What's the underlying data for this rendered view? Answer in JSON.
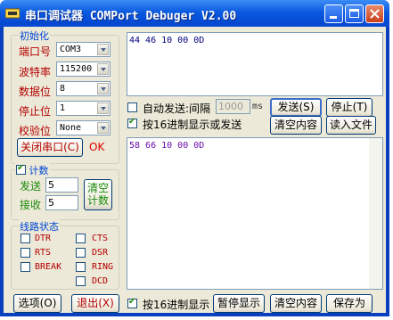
{
  "window": {
    "title": "串口调试器 COMPort Debuger V2.00"
  },
  "settings": {
    "group_label": "初始化",
    "port_label": "端口号",
    "port_value": "COM3",
    "baud_label": "波特率",
    "baud_value": "115200",
    "databits_label": "数据位",
    "databits_value": "8",
    "stopbits_label": "停止位",
    "stopbits_value": "1",
    "parity_label": "校验位",
    "parity_value": "None",
    "close_port_label": "关闭串口(C)",
    "status_text": "OK"
  },
  "count": {
    "label": "计数",
    "checked": true,
    "send_label": "发送",
    "send_value": "5",
    "recv_label": "接收",
    "recv_value": "5",
    "clear_label": "清空\n计数"
  },
  "line_status": {
    "label": "线路状态",
    "items": [
      "DTR",
      "CTS",
      "RTS",
      "DSR",
      "BREAK",
      "RING",
      "DCD"
    ]
  },
  "send_panel": {
    "text": "44 46 10 00 0D",
    "auto_send_label": "自动发送:间隔",
    "interval_value": "1000",
    "interval_unit": "ms",
    "send_button": "发送(S)",
    "stop_button": "停止(T)",
    "hex_send_label": "按16进制显示或发送",
    "clear_button": "清空内容",
    "read_file_button": "读入文件"
  },
  "recv_panel": {
    "text": "58 66 10 00 0D",
    "hex_display_label": "按16进制显示",
    "pause_button": "暂停显示",
    "clear_button": "清空内容",
    "save_button": "保存为"
  },
  "footer": {
    "options_button": "选项(O)",
    "exit_button": "退出(X)"
  }
}
